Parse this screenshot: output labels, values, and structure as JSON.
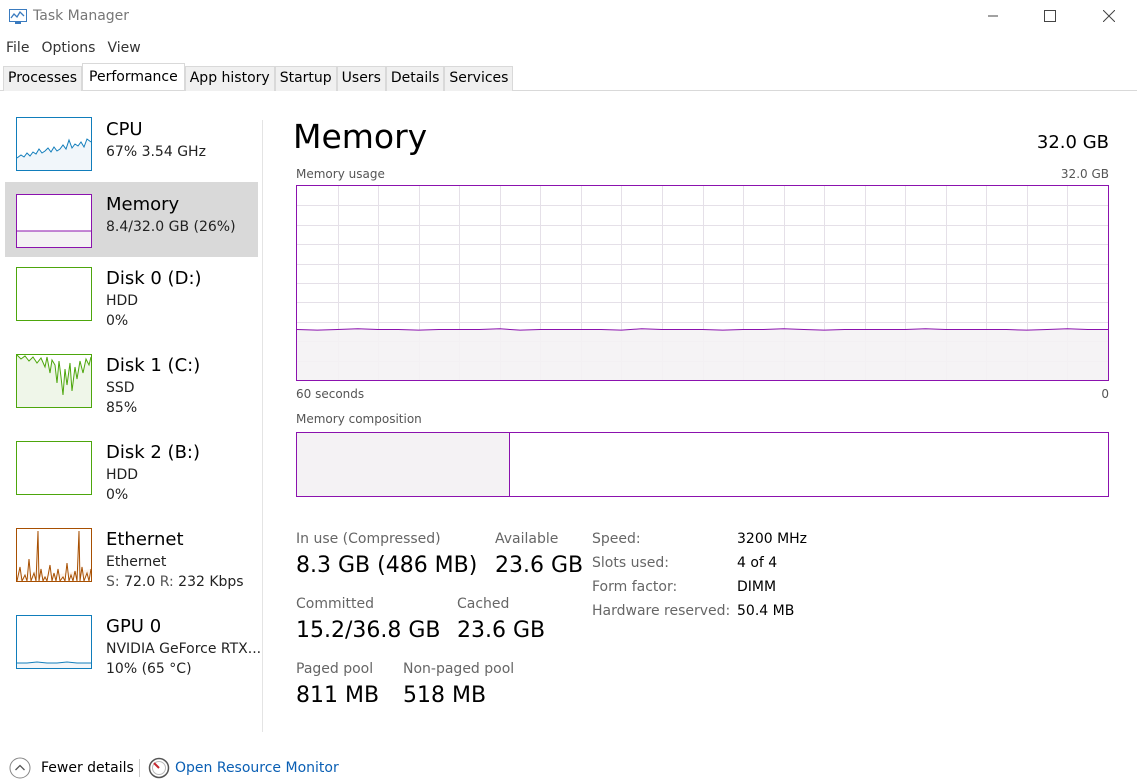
{
  "window": {
    "title": "Task Manager"
  },
  "menu": [
    "File",
    "Options",
    "View"
  ],
  "tabs": [
    "Processes",
    "Performance",
    "App history",
    "Startup",
    "Users",
    "Details",
    "Services"
  ],
  "active_tab": "Performance",
  "sidebar": {
    "items": [
      {
        "title": "CPU",
        "line1": "67% 3.54 GHz",
        "line2": "",
        "color": "#117dbb"
      },
      {
        "title": "Memory",
        "line1": "8.4/32.0 GB (26%)",
        "line2": "",
        "color": "#8b12ae"
      },
      {
        "title": "Disk 0 (D:)",
        "line1": "HDD",
        "line2": "0%",
        "color": "#4da60c"
      },
      {
        "title": "Disk 1 (C:)",
        "line1": "SSD",
        "line2": "85%",
        "color": "#4da60c"
      },
      {
        "title": "Disk 2 (B:)",
        "line1": "HDD",
        "line2": "0%",
        "color": "#4da60c"
      },
      {
        "title": "Ethernet",
        "line1": "Ethernet",
        "line2_s_label": "S:",
        "line2_s": "72.0",
        "line2_r_label": "R:",
        "line2_r": "232 Kbps",
        "color": "#a74f01"
      },
      {
        "title": "GPU 0",
        "line1": "NVIDIA GeForce RTX...",
        "line2": "10% (65 °C)",
        "color": "#117dbb"
      }
    ]
  },
  "main": {
    "title": "Memory",
    "total": "32.0 GB",
    "usage_label": "Memory usage",
    "usage_max": "32.0 GB",
    "time_left": "60 seconds",
    "time_right": "0",
    "composition_label": "Memory composition",
    "usage_fraction": 0.26,
    "composition_in_use_fraction": 0.263,
    "stats": {
      "in_use_label": "In use (Compressed)",
      "in_use_value": "8.3 GB (486 MB)",
      "available_label": "Available",
      "available_value": "23.6 GB",
      "committed_label": "Committed",
      "committed_value": "15.2/36.8 GB",
      "cached_label": "Cached",
      "cached_value": "23.6 GB",
      "paged_label": "Paged pool",
      "paged_value": "811 MB",
      "nonpaged_label": "Non-paged pool",
      "nonpaged_value": "518 MB"
    },
    "info": [
      {
        "label": "Speed:",
        "value": "3200 MHz"
      },
      {
        "label": "Slots used:",
        "value": "4 of 4"
      },
      {
        "label": "Form factor:",
        "value": "DIMM"
      },
      {
        "label": "Hardware reserved:",
        "value": "50.4 MB"
      }
    ]
  },
  "footer": {
    "fewer_details": "Fewer details",
    "open_resource_monitor": "Open Resource Monitor"
  },
  "colors": {
    "memory": "#8b12ae",
    "link": "#0a5fb4"
  }
}
